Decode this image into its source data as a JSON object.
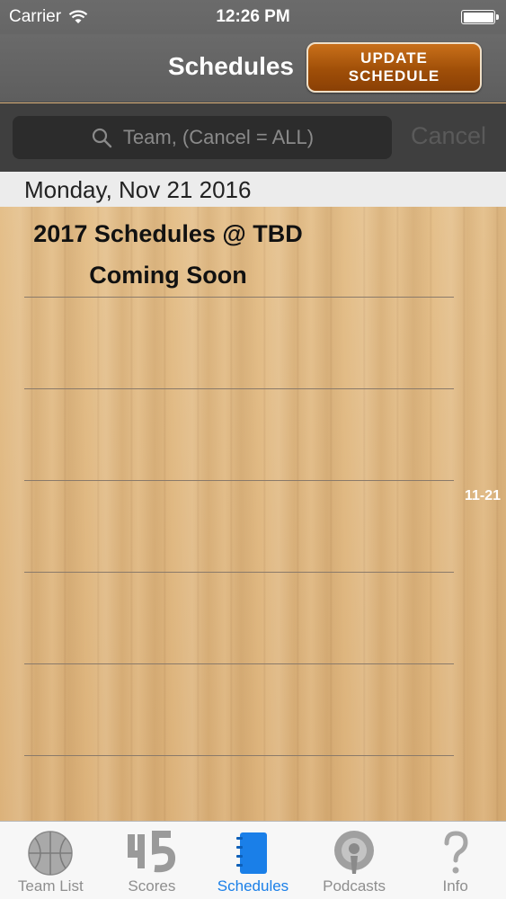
{
  "status_bar": {
    "carrier": "Carrier",
    "time": "12:26 PM"
  },
  "nav": {
    "title": "Schedules",
    "update_line1": "Update",
    "update_line2": "Schedule"
  },
  "search": {
    "placeholder": "Team, (Cancel = ALL)",
    "cancel_label": "Cancel"
  },
  "section": {
    "date_header": "Monday, Nov 21 2016"
  },
  "list": {
    "title_line1": "2017 Schedules @ TBD",
    "title_line2": "Coming Soon",
    "index_label": "11-21"
  },
  "tabs": [
    {
      "label": "Team List",
      "icon": "basketball-icon"
    },
    {
      "label": "Scores",
      "icon": "scores-45-icon"
    },
    {
      "label": "Schedules",
      "icon": "notebook-icon",
      "active": true
    },
    {
      "label": "Podcasts",
      "icon": "podcast-icon"
    },
    {
      "label": "Info",
      "icon": "question-mark-icon"
    }
  ],
  "colors": {
    "accent": "#1a7fe8",
    "update_button": "#a04f08",
    "wood": "#dcb27a"
  }
}
